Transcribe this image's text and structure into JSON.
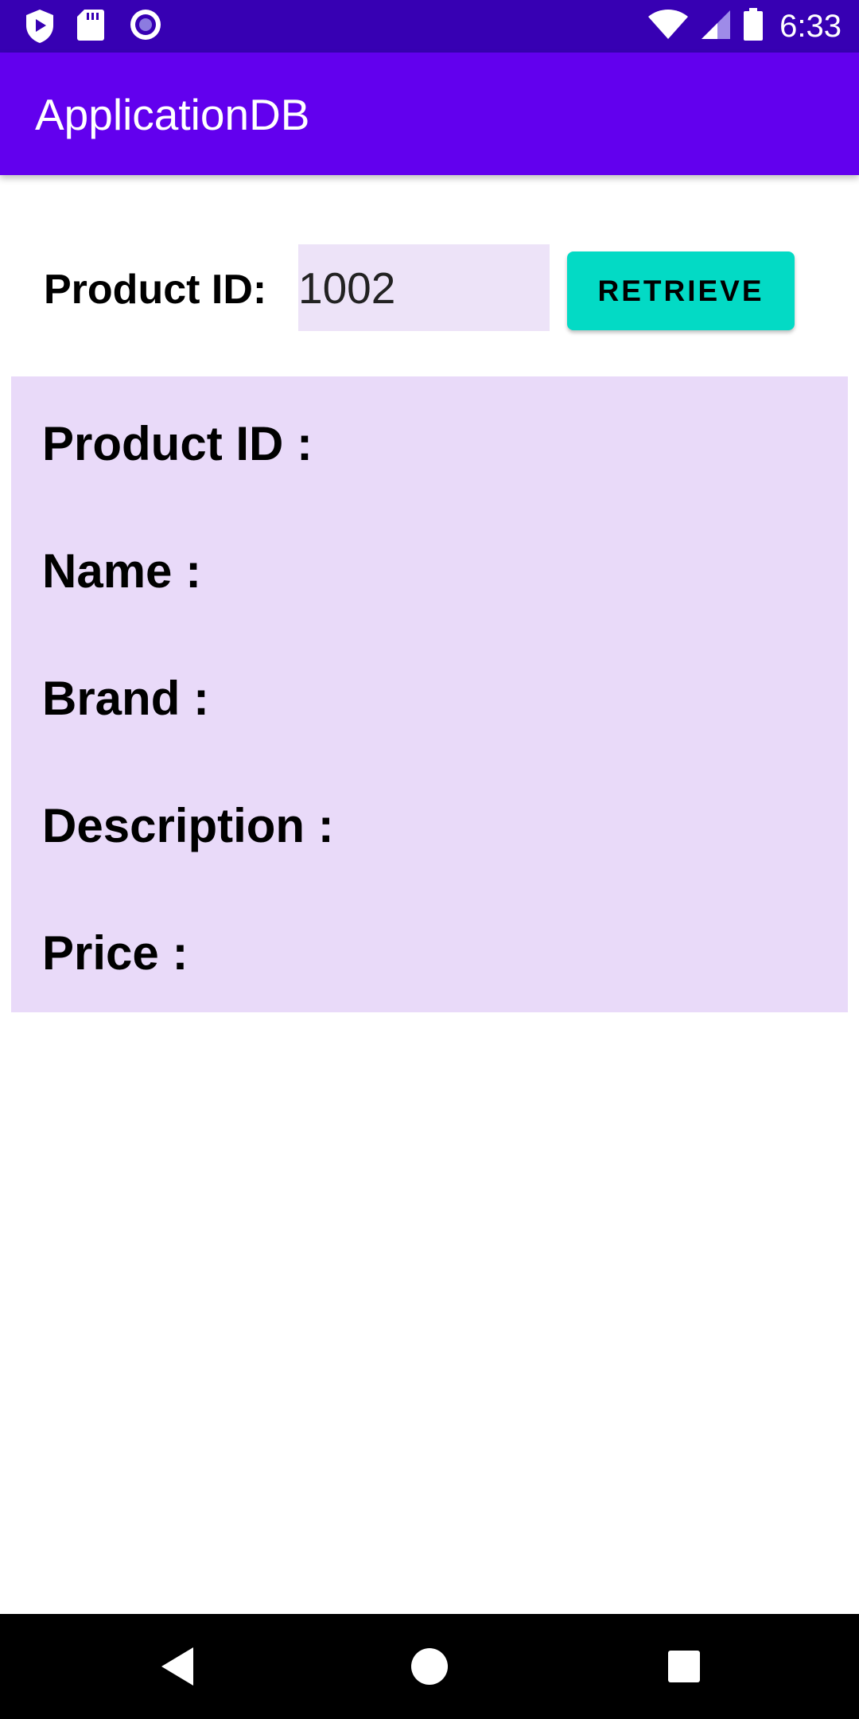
{
  "status_bar": {
    "time": "6:33",
    "left_icons": [
      "shield-play-icon",
      "sd-card-icon",
      "record-icon"
    ],
    "right_icons": [
      "wifi-icon",
      "cell-signal-icon",
      "battery-icon"
    ]
  },
  "app_bar": {
    "title": "ApplicationDB"
  },
  "query": {
    "label": "Product ID:",
    "input_value": "1002",
    "button_label": "RETRIEVE"
  },
  "result": {
    "product_id_label": "Product ID :",
    "name_label": "Name :",
    "brand_label": "Brand :",
    "description_label": "Description :",
    "price_label": "Price :"
  },
  "nav_bar": {
    "buttons": [
      "back-icon",
      "home-icon",
      "recents-icon"
    ]
  },
  "colors": {
    "status_bar": "#3700B3",
    "app_bar": "#6200EE",
    "button": "#03DAC5",
    "panel": "#E9DAF9",
    "input": "#EDE3F8"
  }
}
